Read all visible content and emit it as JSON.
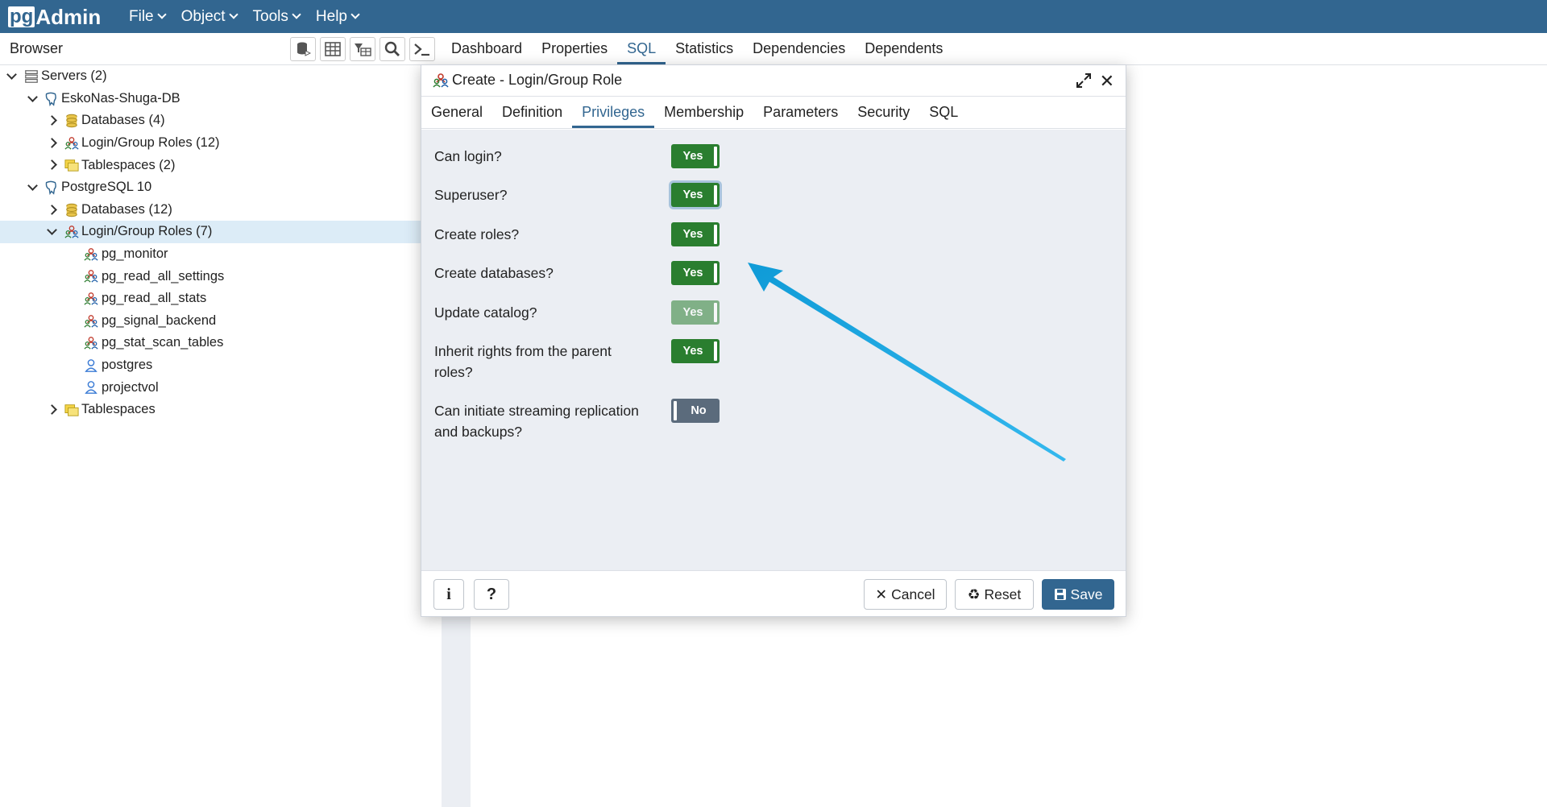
{
  "app": {
    "logo_pg": "pg",
    "logo_admin": "Admin"
  },
  "menu": [
    {
      "label": "File"
    },
    {
      "label": "Object"
    },
    {
      "label": "Tools"
    },
    {
      "label": "Help"
    }
  ],
  "browser": {
    "title": "Browser",
    "toolbar_icons": [
      "query-tool-icon",
      "view-data-icon",
      "filtered-rows-icon",
      "search-objects-icon",
      "psql-tool-icon"
    ]
  },
  "main_tabs": [
    {
      "label": "Dashboard"
    },
    {
      "label": "Properties"
    },
    {
      "label": "SQL",
      "active": true
    },
    {
      "label": "Statistics"
    },
    {
      "label": "Dependencies"
    },
    {
      "label": "Dependents"
    }
  ],
  "tree": [
    {
      "label": "Servers (2)",
      "level": 0,
      "expanded": true,
      "icon": "servers-icon"
    },
    {
      "label": "EskoNas-Shuga-DB",
      "level": 1,
      "expanded": true,
      "icon": "server-elephant-icon"
    },
    {
      "label": "Databases (4)",
      "level": 2,
      "expanded": false,
      "icon": "databases-icon"
    },
    {
      "label": "Login/Group Roles (12)",
      "level": 2,
      "expanded": false,
      "icon": "group-roles-icon"
    },
    {
      "label": "Tablespaces (2)",
      "level": 2,
      "expanded": false,
      "icon": "tablespaces-icon"
    },
    {
      "label": "PostgreSQL 10",
      "level": 1,
      "expanded": true,
      "icon": "server-elephant-icon"
    },
    {
      "label": "Databases (12)",
      "level": 2,
      "expanded": false,
      "icon": "databases-icon"
    },
    {
      "label": "Login/Group Roles (7)",
      "level": 2,
      "expanded": true,
      "selected": true,
      "icon": "group-roles-icon"
    },
    {
      "label": "pg_monitor",
      "level": 3,
      "icon": "group-role-icon"
    },
    {
      "label": "pg_read_all_settings",
      "level": 3,
      "icon": "group-role-icon"
    },
    {
      "label": "pg_read_all_stats",
      "level": 3,
      "icon": "group-role-icon"
    },
    {
      "label": "pg_signal_backend",
      "level": 3,
      "icon": "group-role-icon"
    },
    {
      "label": "pg_stat_scan_tables",
      "level": 3,
      "icon": "group-role-icon"
    },
    {
      "label": "postgres",
      "level": 3,
      "icon": "login-role-icon"
    },
    {
      "label": "projectvol",
      "level": 3,
      "icon": "login-role-icon"
    },
    {
      "label": "Tablespaces",
      "level": 2,
      "expanded": false,
      "icon": "tablespaces-icon"
    }
  ],
  "dialog": {
    "title": "Create - Login/Group Role",
    "tabs": [
      {
        "label": "General"
      },
      {
        "label": "Definition"
      },
      {
        "label": "Privileges",
        "active": true
      },
      {
        "label": "Membership"
      },
      {
        "label": "Parameters"
      },
      {
        "label": "Security"
      },
      {
        "label": "SQL"
      }
    ],
    "privileges": [
      {
        "label": "Can login?",
        "value": "Yes",
        "on": true
      },
      {
        "label": "Superuser?",
        "value": "Yes",
        "on": true,
        "focused": true
      },
      {
        "label": "Create roles?",
        "value": "Yes",
        "on": true
      },
      {
        "label": "Create databases?",
        "value": "Yes",
        "on": true
      },
      {
        "label": "Update catalog?",
        "value": "Yes",
        "on": true,
        "disabled": true
      },
      {
        "label": "Inherit rights from the parent roles?",
        "value": "Yes",
        "on": true
      },
      {
        "label": "Can initiate streaming replication and backups?",
        "value": "No",
        "on": false
      }
    ],
    "footer": {
      "info_label": "i",
      "help_label": "?",
      "cancel_label": "Cancel",
      "reset_label": "Reset",
      "save_label": "Save"
    }
  },
  "colors": {
    "brand": "#326690",
    "toggle_on": "#2a7e2f",
    "toggle_off": "#5b6b7c",
    "selected_row": "#dcecf7",
    "annotation_arrow": "#1aa7e0"
  }
}
